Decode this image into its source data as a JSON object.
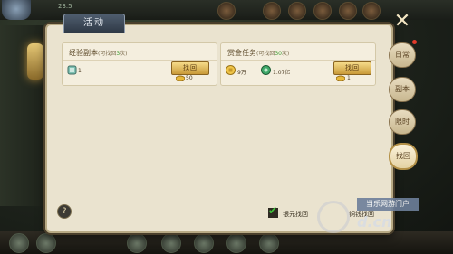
{
  "hud": {
    "hp_text": "23.5"
  },
  "panel": {
    "title": "活动",
    "cards": [
      {
        "title": "经验副本",
        "subtitle_prefix": "(可找回",
        "subtitle_count": "3",
        "subtitle_suffix": "次)",
        "button": "找回",
        "reward_left": "1",
        "reward_cost": "50"
      },
      {
        "title": "赏金任务",
        "subtitle_prefix": "(可找回",
        "subtitle_count": "30",
        "subtitle_suffix": "次)",
        "button": "找回",
        "reward_gold": "9万",
        "reward_exp": "1.07亿",
        "reward_cost": "1"
      }
    ],
    "help": "?",
    "yuanbao_option": "银元找回",
    "copper_option": "铜钱找回"
  },
  "side_tabs": [
    "日常",
    "副本",
    "限时",
    "找回"
  ],
  "watermark": {
    "tag": "当乐网游门户",
    "logo": "d.cn"
  },
  "colors": {
    "accent_gold": "#c99a38",
    "panel_bg": "#eae3cf",
    "count_green": "#3a9a2e"
  }
}
